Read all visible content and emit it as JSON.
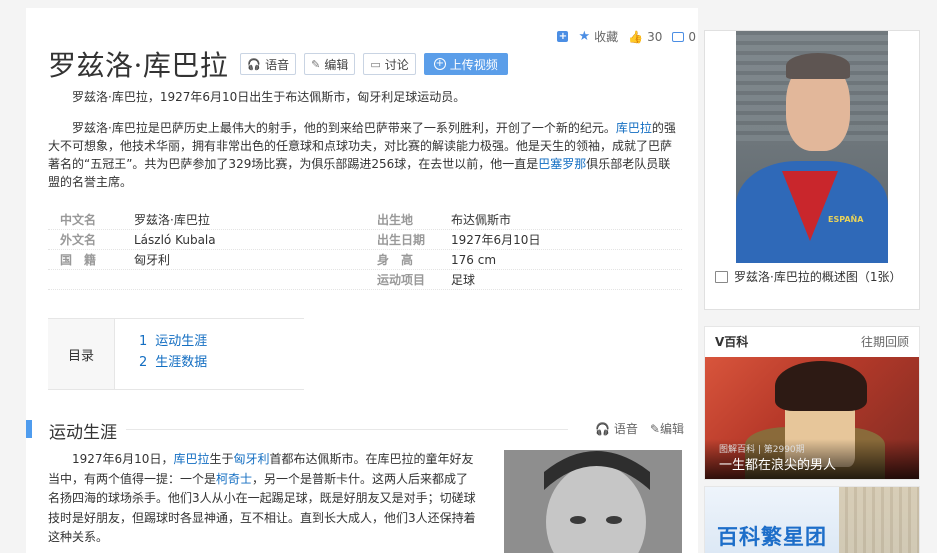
{
  "header": {
    "actions": {
      "collect_label": "收藏",
      "like_count": "30",
      "share_count": "0"
    },
    "title": "罗兹洛·库巴拉",
    "buttons": {
      "voice": "语音",
      "edit": "编辑",
      "discuss": "讨论",
      "upload_video": "上传视频"
    }
  },
  "summary": {
    "intro": "罗兹洛·库巴拉，1927年6月10日出生于布达佩斯市，匈牙利足球运动员。",
    "p2_a": "罗兹洛·库巴拉是巴萨历史上最伟大的射手，他的到来给巴萨带来了一系列胜利，开创了一个新的纪元。",
    "p2_link1": "库巴拉",
    "p2_b": "的强大不可想象，他技术华丽，拥有非常出色的任意球和点球功夫，对比赛的解读能力极强。他是天生的领袖，成就了巴萨著名的“五冠王”。共为巴萨参加了329场比赛，为俱乐部踢进256球，在去世以前，他一直是",
    "p2_link2": "巴塞罗那",
    "p2_c": "俱乐部老队员联盟的名誉主席。"
  },
  "basic_info": {
    "rows": [
      {
        "k1": "中文名",
        "v1": "罗兹洛·库巴拉",
        "k2": "出生地",
        "v2": "布达佩斯市"
      },
      {
        "k1": "外文名",
        "v1": "László Kubala",
        "k2": "出生日期",
        "v2": "1927年6月10日"
      },
      {
        "k1": "国　籍",
        "v1": "匈牙利",
        "k2": "身　高",
        "v2": "176 cm"
      },
      {
        "k1": "",
        "v1": "",
        "k2": "运动项目",
        "v2": "足球"
      }
    ]
  },
  "catalog": {
    "label": "目录",
    "items": [
      {
        "num": "1",
        "text": "运动生涯"
      },
      {
        "num": "2",
        "text": "生涯数据"
      }
    ]
  },
  "section1": {
    "title": "运动生涯",
    "voice": "语音",
    "edit": "编辑",
    "text_a": "1927年6月10日，",
    "link1": "库巴拉",
    "text_b": "生于",
    "link2": "匈牙利",
    "text_c": "首都布达佩斯市。在库巴拉的童年好友当中，有两个值得一提：一个是",
    "link3": "柯奇士",
    "text_d": "，另一个是普斯卡什。这两人后来都成了名扬四海的球场杀手。他们3人从小在一起踢足球，既是好朋友又是对手；切磋球技时是好朋友，但踢球时各显神通，互不相让。直到长大成人，他们3人还保持着这种关系。"
  },
  "sidebar": {
    "profile_caption": "罗兹洛·库巴拉的概述图（1张）",
    "profile_badge": "ESPAÑA",
    "vbaike": {
      "title": "V百科",
      "more": "往期回顾",
      "sub": "图解百科 | 第2990期",
      "caption": "一生都在浪尖的男人"
    },
    "star_title": "百科繁星团"
  }
}
